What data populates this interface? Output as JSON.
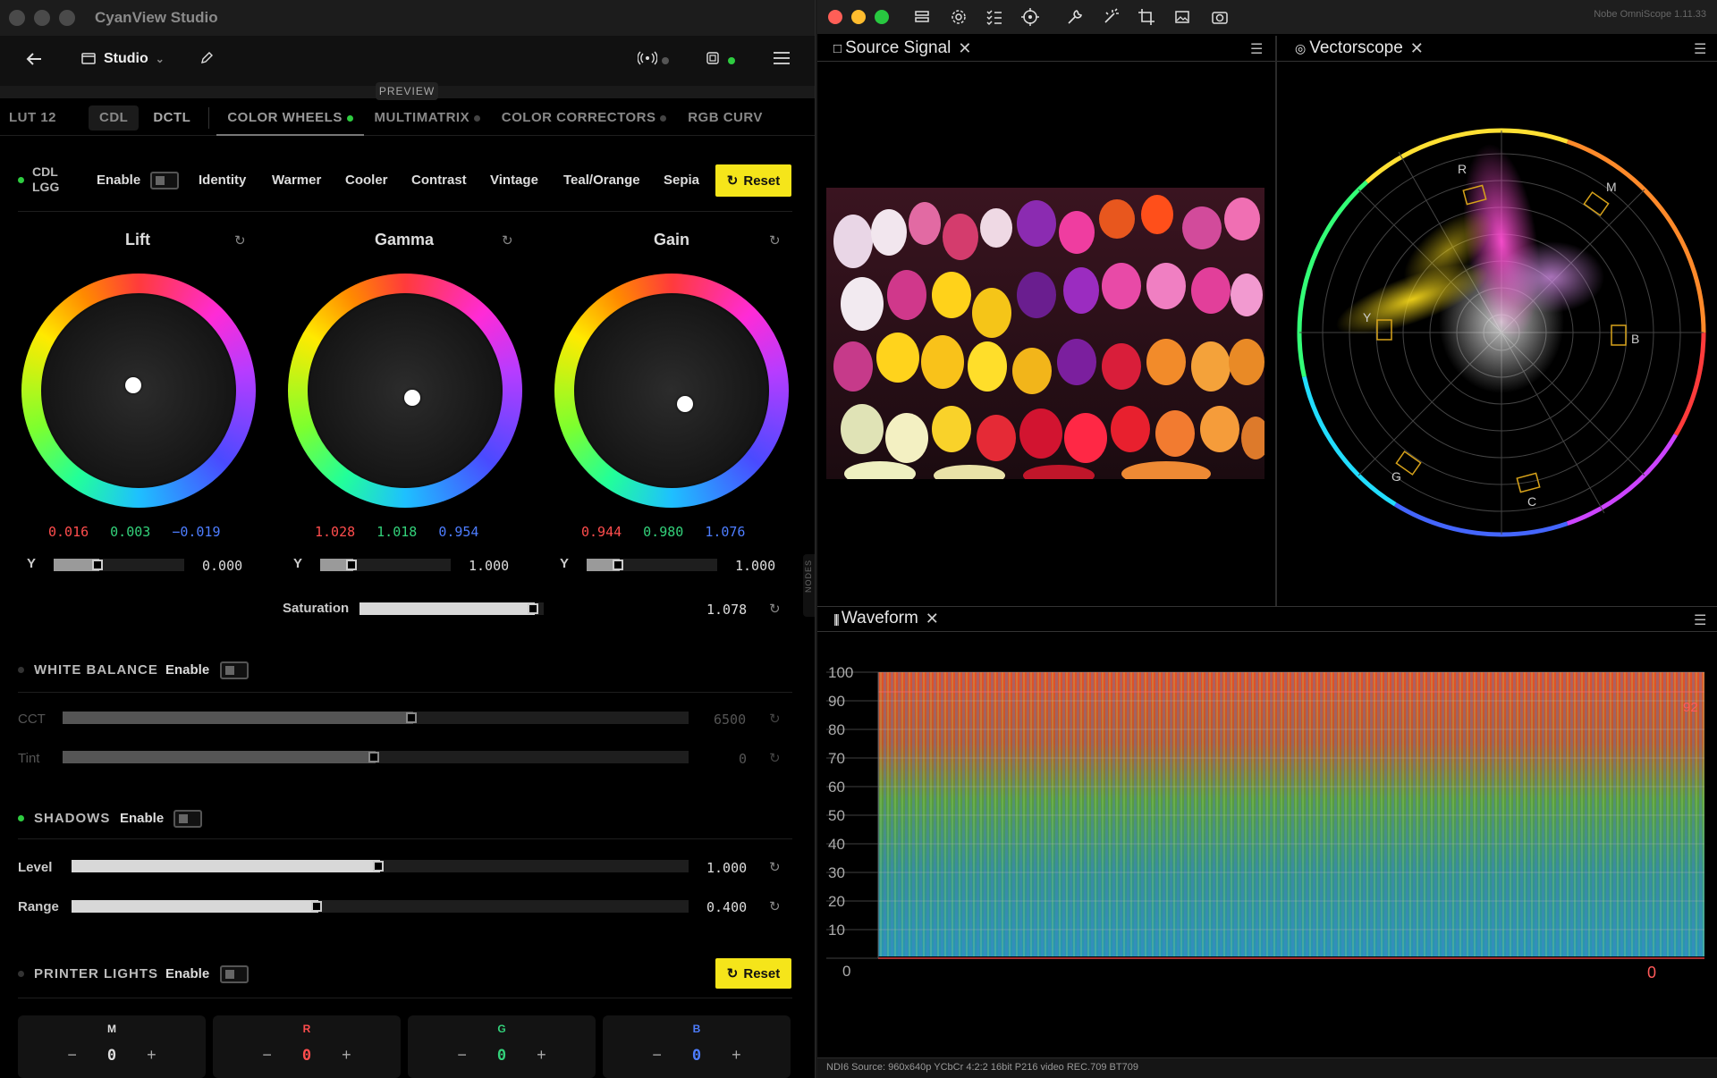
{
  "app": {
    "title": "CyanView Studio",
    "studio_label": "Studio",
    "preview_label": "PREVIEW",
    "tabs": [
      "LUT 12",
      "CDL",
      "DCTL",
      "COLOR WHEELS",
      "MULTIMATRIX",
      "COLOR CORRECTORS",
      "RGB CURV"
    ],
    "active_tab": "COLOR WHEELS",
    "nodes_label": "NODES"
  },
  "cdl": {
    "label_line1": "CDL",
    "label_line2": "LGG",
    "enable_label": "Enable",
    "presets": [
      "Identity",
      "Warmer",
      "Cooler",
      "Contrast",
      "Vintage",
      "Teal/Orange",
      "Sepia"
    ],
    "reset_label": "Reset"
  },
  "wheels": [
    {
      "title": "Lift",
      "r": "0.016",
      "g": "0.003",
      "b": "−0.019",
      "y_label": "Y",
      "y_value": "0.000",
      "y_level": 0.35
    },
    {
      "title": "Gamma",
      "r": "1.028",
      "g": "1.018",
      "b": "0.954",
      "y_label": "Y",
      "y_value": "1.000",
      "y_level": 0.25
    },
    {
      "title": "Gain",
      "r": "0.944",
      "g": "0.980",
      "b": "1.076",
      "y_label": "Y",
      "y_value": "1.000",
      "y_level": 0.25
    }
  ],
  "saturation": {
    "label": "Saturation",
    "value": "1.078",
    "level": 0.95
  },
  "white_balance": {
    "title": "WHITE BALANCE",
    "enable_label": "Enable",
    "cct_label": "CCT",
    "cct_value": "6500",
    "cct_level": 0.56,
    "tint_label": "Tint",
    "tint_value": "0",
    "tint_level": 0.5
  },
  "shadows": {
    "title": "SHADOWS",
    "enable_label": "Enable",
    "level_label": "Level",
    "level_value": "1.000",
    "level_level": 0.5,
    "range_label": "Range",
    "range_value": "0.400",
    "range_level": 0.4
  },
  "printer_lights": {
    "title": "PRINTER LIGHTS",
    "enable_label": "Enable",
    "reset_label": "Reset",
    "channels": [
      {
        "label": "M",
        "value": "0",
        "color": "#dddddd"
      },
      {
        "label": "R",
        "value": "0",
        "color": "#ff4d4d"
      },
      {
        "label": "G",
        "value": "0",
        "color": "#33d17a"
      },
      {
        "label": "B",
        "value": "0",
        "color": "#4d7dff"
      }
    ]
  },
  "scope": {
    "version": "Nobe OmniScope 1.11.33",
    "source_title": "Source Signal",
    "vectorscope_title": "Vectorscope",
    "waveform_title": "Waveform",
    "vector_labels": [
      "R",
      "M",
      "B",
      "C",
      "G",
      "Y"
    ],
    "waveform_ticks": [
      "100",
      "90",
      "80",
      "70",
      "60",
      "50",
      "40",
      "30",
      "20",
      "10",
      "0"
    ],
    "waveform_right_top": "92",
    "waveform_right_bottom": "0",
    "status": "NDI6 Source: 960x640p YCbCr 4:2:2 16bit P216 video REC.709 BT709"
  },
  "colors": {
    "accent": "#f5e51a",
    "red": "#ff4d4d",
    "green": "#33d17a",
    "blue": "#4d7dff",
    "status_green": "#2ecc40"
  }
}
